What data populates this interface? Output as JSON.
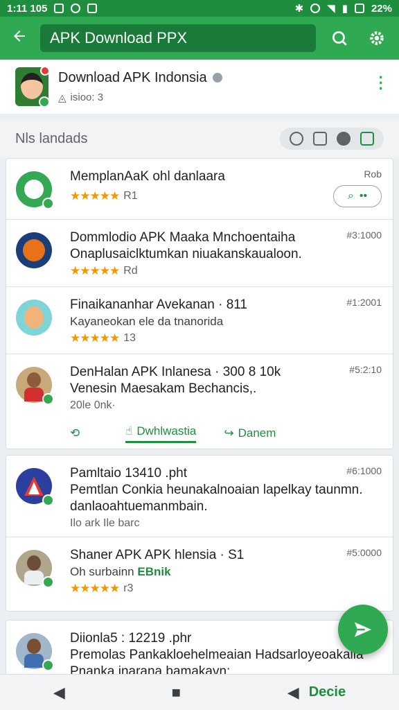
{
  "status": {
    "time": "1:11 105",
    "battery": "22%"
  },
  "appbar": {
    "search_text": "APK Download PPX"
  },
  "publisher": {
    "name": "Download APK Indonsia",
    "sub": "isioo: 3"
  },
  "section": {
    "title": "Nls landads"
  },
  "items": [
    {
      "name": "MemplanAaK ohl danlaara",
      "desc": "",
      "rating": "★★★★★",
      "rating_count": "R1",
      "right": "Rob"
    },
    {
      "name": "Dommlodio APK Maaka  Mnchoentaiha",
      "desc": "Onaplusaiclktumkan niuakanskaualoon.",
      "rating": "★★★★★",
      "rating_count": "Rd",
      "right": "#3:1000"
    },
    {
      "name": "Finaikananhar Avekanan  ·  811",
      "desc": "Kayaneokan ele da tnanorida",
      "rating": "★★★★★",
      "rating_count": "13",
      "right": "#1:2001"
    },
    {
      "name": "DenHalan APK Inlanesa  ·  300 8 10k",
      "desc": "Venesin Maesakam Bechancis,.",
      "rating": "",
      "rating_count": "20le 0nk·",
      "right": "#5:2:10"
    }
  ],
  "actions": {
    "download": "Dwhlwastia",
    "share": "Danem"
  },
  "items2": [
    {
      "name": "Pamltaio  13410 .pht",
      "desc": "Pemtlan Conkia heunakalnoaian lapelkay taunmn. danlaoahtuemanmbain.",
      "rating_count": "Ilo ark Ile barc",
      "right": "#6:1000"
    },
    {
      "name": "Shaner APK APK hlensia  ·  S1",
      "desc": "Oh surbainn",
      "extra": "EBnik",
      "rating": "★★★★★",
      "rating_count": "r3",
      "right": "#5:0000"
    }
  ],
  "items3": [
    {
      "name": "Diionla5   : 12219 .phr",
      "desc": "Premolas Pankakloehelmeaian Hadsarloyeoakaila Pnanka inarana bamakavn:"
    }
  ],
  "navbar": {
    "more": "Decie"
  },
  "colors": {
    "accent": "#2faa53",
    "dark_accent": "#1e8e3e",
    "star": "#f29900"
  }
}
